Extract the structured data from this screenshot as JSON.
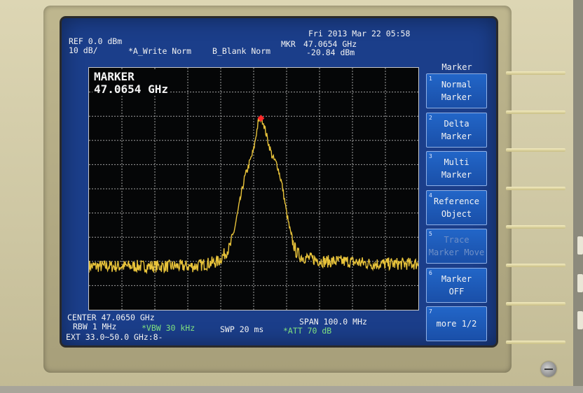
{
  "datetime": "Fri 2013 Mar 22 05:58",
  "header": {
    "ref_level": "REF 0.0 dBm",
    "scale": "10 dB/",
    "trace_a": "*A_Write Norm",
    "trace_b": "B_Blank Norm",
    "mkr_label": "MKR",
    "mkr_freq": "47.0654 GHz",
    "mkr_level": "-20.84 dBm"
  },
  "marker_box": {
    "title": "MARKER",
    "freq": "47.0654 GHz"
  },
  "menu": {
    "title": "Marker",
    "softkeys": [
      {
        "num": "1",
        "line1": "Normal",
        "line2": "Marker",
        "enabled": true
      },
      {
        "num": "2",
        "line1": "Delta",
        "line2": "Marker",
        "enabled": true
      },
      {
        "num": "3",
        "line1": "Multi",
        "line2": "Marker",
        "enabled": true
      },
      {
        "num": "4",
        "line1": "Reference",
        "line2": "Object",
        "enabled": true
      },
      {
        "num": "5",
        "line1": "Trace",
        "line2": "Marker Move",
        "enabled": false
      },
      {
        "num": "6",
        "line1": "Marker",
        "line2": "OFF",
        "enabled": true
      },
      {
        "num": "7",
        "line1": "more 1/2",
        "line2": "",
        "enabled": true
      }
    ]
  },
  "footer": {
    "center": "CENTER 47.0650 GHz",
    "span": "SPAN 100.0 MHz",
    "rbw": "RBW 1 MHz",
    "vbw": "*VBW 30 kHz",
    "swp": "SWP 20 ms",
    "att": "*ATT 70 dB",
    "ext": "EXT 33.0~50.0 GHz:8-"
  },
  "colors": {
    "screen_bg": "#1b3e8a",
    "trace": "#e7c23a",
    "marker_dot": "#ff2a2a",
    "grid": "#c8c8c8",
    "highlight_text": "#7fe07f"
  },
  "chart_data": {
    "type": "line",
    "grid": true,
    "x": [
      46.7,
      46.725,
      46.75,
      46.775,
      46.8,
      46.825,
      46.85,
      46.875,
      46.9,
      46.925,
      46.95,
      46.975,
      47.0,
      47.01,
      47.02,
      47.03,
      47.04,
      47.05,
      47.06,
      47.0654,
      47.07,
      47.08,
      47.09,
      47.1,
      47.11,
      47.12,
      47.13,
      47.14,
      47.15,
      47.175,
      47.2,
      47.225,
      47.25,
      47.275,
      47.3,
      47.325,
      47.35,
      47.375,
      47.4
    ],
    "y": [
      -82,
      -82,
      -82,
      -82,
      -82,
      -82,
      -82,
      -82,
      -82,
      -82,
      -81,
      -80,
      -74,
      -66,
      -56,
      -46,
      -40,
      -34,
      -22,
      -20.84,
      -22,
      -30,
      -37,
      -40,
      -48,
      -60,
      -70,
      -76,
      -78,
      -79,
      -80,
      -80,
      -80,
      -80.5,
      -81,
      -81,
      -81,
      -81,
      -81
    ],
    "xlim": [
      46.7,
      47.4
    ],
    "ylim": [
      -100,
      0
    ],
    "marker": {
      "x": 47.0654,
      "y": -20.84
    }
  }
}
